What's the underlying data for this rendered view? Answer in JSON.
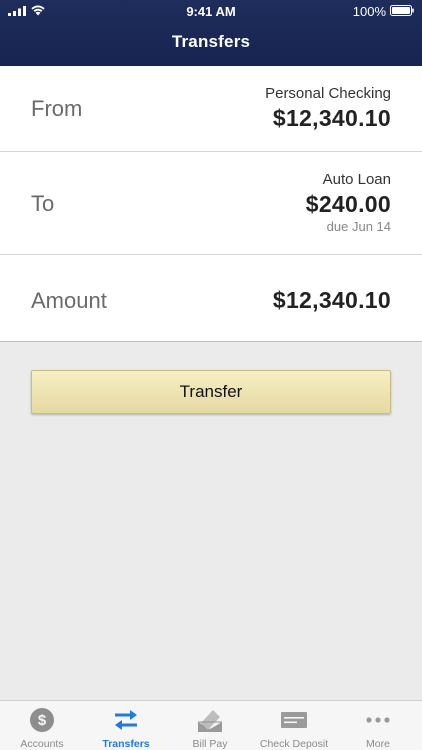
{
  "status_bar": {
    "time": "9:41 AM",
    "battery": "100%",
    "icons": [
      "signal-icon",
      "wifi-icon",
      "battery-icon"
    ]
  },
  "nav": {
    "title": "Transfers"
  },
  "transfer_form": {
    "from": {
      "label": "From",
      "account": "Personal Checking",
      "amount": "$12,340.10"
    },
    "to": {
      "label": "To",
      "account": "Auto Loan",
      "amount": "$240.00",
      "due": "due Jun 14"
    },
    "amount": {
      "label": "Amount",
      "value": "$12,340.10"
    }
  },
  "actions": {
    "transfer_label": "Transfer"
  },
  "tabbar": {
    "active_color": "#1e7be0",
    "items": [
      {
        "label": "Accounts",
        "icon": "dollar-circle-icon"
      },
      {
        "label": "Transfers",
        "icon": "swap-arrows-icon",
        "active": true
      },
      {
        "label": "Bill Pay",
        "icon": "envelope-icon"
      },
      {
        "label": "Check Deposit",
        "icon": "check-icon"
      },
      {
        "label": "More",
        "icon": "more-icon"
      }
    ]
  }
}
